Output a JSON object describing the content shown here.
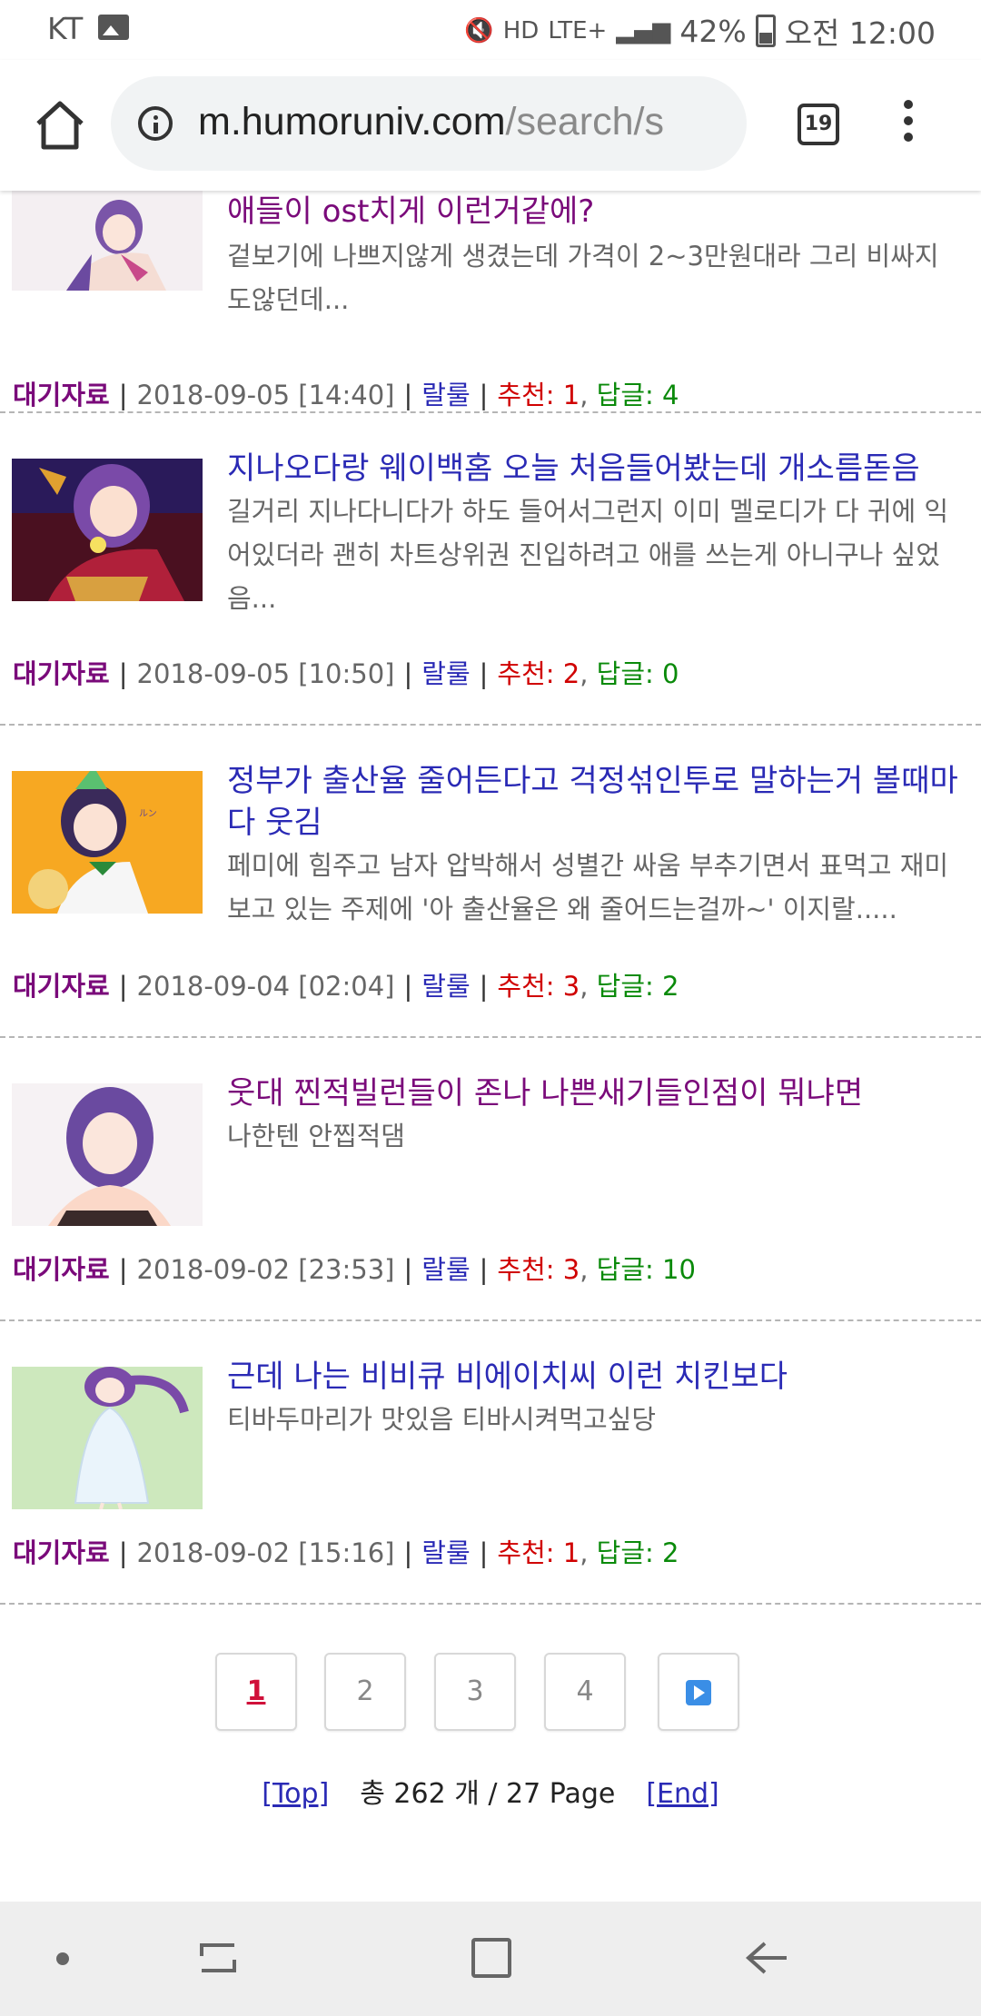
{
  "status": {
    "carrier": "KT",
    "network": "LTE+",
    "battery": "42%",
    "time": "오전 12:00"
  },
  "browser": {
    "url_domain": "m.humoruniv.com",
    "url_path": "/search/s",
    "tab_count": "19"
  },
  "posts": [
    {
      "title": "애들이 ost치게 이런거같에?",
      "excerpt": "겉보기에 나쁘지않게 생겼는데 가격이 2~3만원대라 그리 비싸지 도않던데...",
      "category": "대기자료",
      "date": "2018-09-05 [14:40]",
      "author": "랄룰",
      "rec_label": "추천: 1",
      "reply_label": "답글: 4"
    },
    {
      "title": "지나오다랑 웨이백홈 오늘 처음들어봤는데 개소름돋음",
      "excerpt": "길거리 지나다니다가 하도 들어서그런지 이미 멜로디가 다 귀에 익어있더라 괜히 차트상위권 진입하려고 애를 쓰는게 아니구나 싶었음...",
      "category": "대기자료",
      "date": "2018-09-05 [10:50]",
      "author": "랄룰",
      "rec_label": "추천: 2",
      "reply_label": "답글: 0"
    },
    {
      "title": "정부가 출산율 줄어든다고 걱정섞인투로 말하는거 볼때마다 웃김",
      "excerpt": "페미에 힘주고 남자 압박해서 성별간 싸움 부추기면서 표먹고 재미보고 있는 주제에 '아 출산율은 왜 줄어드는걸까~' 이지랄.....",
      "category": "대기자료",
      "date": "2018-09-04 [02:04]",
      "author": "랄룰",
      "rec_label": "추천: 3",
      "reply_label": "답글: 2"
    },
    {
      "title": "웃대 찐적빌런들이 존나 나쁜새기들인점이 뭐냐면",
      "excerpt": "나한텐 안찝적댐",
      "category": "대기자료",
      "date": "2018-09-02 [23:53]",
      "author": "랄룰",
      "rec_label": "추천: 3",
      "reply_label": "답글: 10"
    },
    {
      "title": "근데 나는 비비큐 비에이치씨 이런 치킨보다",
      "excerpt": "티바두마리가 맛있음 티바시켜먹고싶당",
      "category": "대기자료",
      "date": "2018-09-02 [15:16]",
      "author": "랄룰",
      "rec_label": "추천: 1",
      "reply_label": "답글: 2"
    }
  ],
  "pagination": {
    "pages": [
      "1",
      "2",
      "3",
      "4"
    ],
    "current": "1",
    "top_label": "[Top]",
    "end_label": "[End]",
    "summary": "총 262 개 / 27 Page"
  },
  "colors": {
    "link": "#2a2ab5",
    "visited": "#7a0a7a",
    "recommend": "#d00000",
    "reply": "#0a8a0a"
  }
}
